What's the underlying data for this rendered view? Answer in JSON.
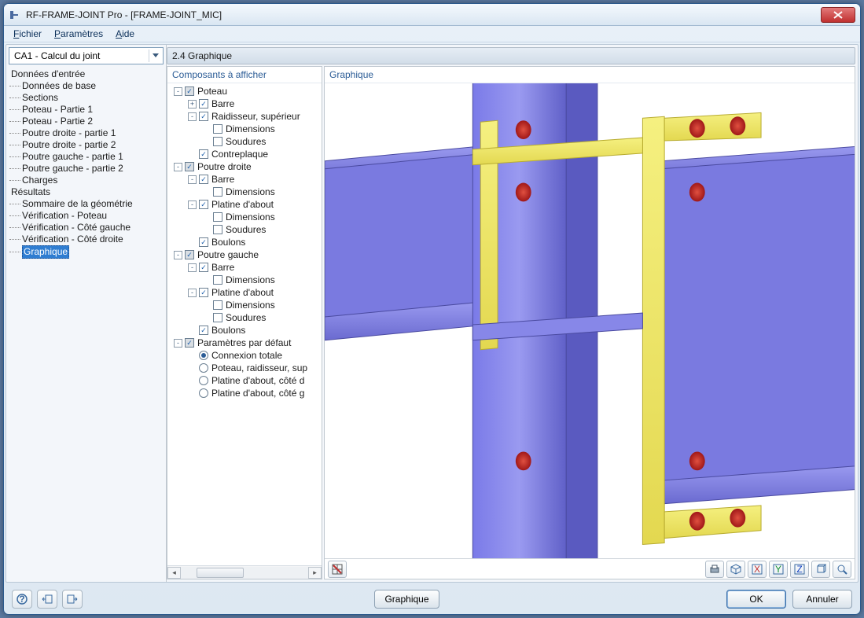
{
  "window": {
    "title": "RF-FRAME-JOINT Pro - [FRAME-JOINT_MIC]"
  },
  "menu": {
    "file": "Fichier",
    "file_u": "F",
    "params": "Paramètres",
    "params_u": "P",
    "help": "Aide",
    "help_u": "A"
  },
  "combo": {
    "value": "CA1 - Calcul du joint"
  },
  "nav": {
    "input_head": "Données d'entrée",
    "input_items": [
      "Données de base",
      "Sections",
      "Poteau - Partie 1",
      "Poteau - Partie 2",
      "Poutre droite - partie 1",
      "Poutre droite - partie 2",
      "Poutre gauche - partie 1",
      "Poutre gauche - partie 2",
      "Charges"
    ],
    "results_head": "Résultats",
    "results_items": [
      "Sommaire de la géométrie",
      "Vérification - Poteau",
      "Vérification - Côté gauche",
      "Vérification - Côté droite",
      "Graphique"
    ],
    "selected": "Graphique"
  },
  "section": {
    "header": "2.4 Graphique"
  },
  "components": {
    "header": "Composants à afficher",
    "tree": [
      {
        "d": 0,
        "exp": "-",
        "chk": "gray",
        "label": "Poteau"
      },
      {
        "d": 1,
        "exp": "+",
        "chk": "on",
        "label": "Barre"
      },
      {
        "d": 1,
        "exp": "-",
        "chk": "on",
        "label": "Raidisseur, supérieur"
      },
      {
        "d": 2,
        "chk": "off",
        "label": "Dimensions"
      },
      {
        "d": 2,
        "chk": "off",
        "label": "Soudures"
      },
      {
        "d": 1,
        "chk": "on",
        "label": "Contreplaque"
      },
      {
        "d": 0,
        "exp": "-",
        "chk": "gray",
        "label": "Poutre droite"
      },
      {
        "d": 1,
        "exp": "-",
        "chk": "on",
        "label": "Barre"
      },
      {
        "d": 2,
        "chk": "off",
        "label": "Dimensions"
      },
      {
        "d": 1,
        "exp": "-",
        "chk": "on",
        "label": "Platine d'about"
      },
      {
        "d": 2,
        "chk": "off",
        "label": "Dimensions"
      },
      {
        "d": 2,
        "chk": "off",
        "label": "Soudures"
      },
      {
        "d": 1,
        "chk": "on",
        "label": "Boulons"
      },
      {
        "d": 0,
        "exp": "-",
        "chk": "gray",
        "label": "Poutre gauche"
      },
      {
        "d": 1,
        "exp": "-",
        "chk": "on",
        "label": "Barre"
      },
      {
        "d": 2,
        "chk": "off",
        "label": "Dimensions"
      },
      {
        "d": 1,
        "exp": "-",
        "chk": "on",
        "label": "Platine d'about"
      },
      {
        "d": 2,
        "chk": "off",
        "label": "Dimensions"
      },
      {
        "d": 2,
        "chk": "off",
        "label": "Soudures"
      },
      {
        "d": 1,
        "chk": "on",
        "label": "Boulons"
      },
      {
        "d": 0,
        "exp": "-",
        "chk": "gray",
        "label": "Paramètres par défaut"
      },
      {
        "d": 1,
        "rad": "on",
        "label": "Connexion totale"
      },
      {
        "d": 1,
        "rad": "off",
        "label": "Poteau, raidisseur, sup"
      },
      {
        "d": 1,
        "rad": "off",
        "label": "Platine d'about, côté d"
      },
      {
        "d": 1,
        "rad": "off",
        "label": "Platine d'about, côté g"
      }
    ]
  },
  "graphic": {
    "header": "Graphique"
  },
  "toolbar_icons": {
    "left": [
      "grid-red-icon"
    ],
    "right": [
      "print-icon",
      "iso-icon",
      "view-x-icon",
      "view-y-icon",
      "view-z-icon",
      "cube-icon",
      "zoom-extent-icon"
    ]
  },
  "footer": {
    "help": "help-icon",
    "lefts": [
      "arrow-left-icon",
      "arrow-right-icon"
    ],
    "center": "Graphique",
    "ok": "OK",
    "cancel": "Annuler"
  }
}
